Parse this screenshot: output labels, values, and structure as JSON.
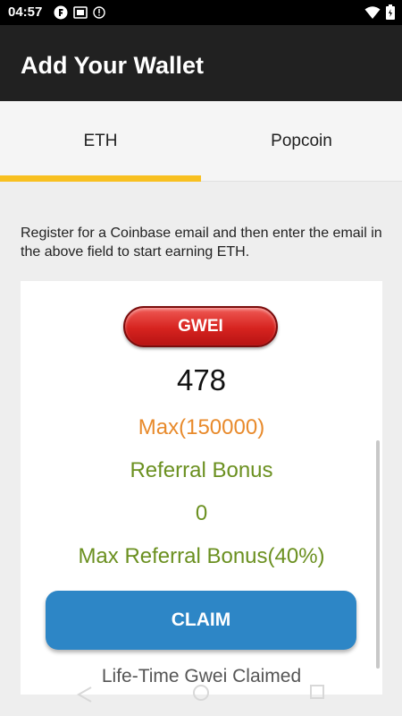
{
  "status_bar": {
    "time": "04:57",
    "left_icons": [
      "app-notification-icon",
      "screenshot-icon",
      "info-icon"
    ],
    "right_icons": [
      "wifi-icon",
      "battery-icon"
    ]
  },
  "app_bar": {
    "title": "Add Your Wallet"
  },
  "tabs": [
    {
      "label": "ETH",
      "selected": true
    },
    {
      "label": "Popcoin",
      "selected": false
    }
  ],
  "colors": {
    "tab_indicator": "#f8c020",
    "max_text": "#e88a2b",
    "referral_text": "#6b9020",
    "claim_button": "#2d86c6",
    "gwei_pill": "#d6231f"
  },
  "description": "Register for a Coinbase email and then enter the email in the above field to start earning ETH.",
  "card": {
    "gwei_label": "GWEI",
    "gwei_value": "478",
    "max_text": "Max(150000)",
    "referral_label": "Referral Bonus",
    "referral_value": "0",
    "max_referral_text": "Max Referral Bonus(40%)",
    "claim_label": "CLAIM",
    "lifetime_label": "Life-Time Gwei Claimed"
  }
}
